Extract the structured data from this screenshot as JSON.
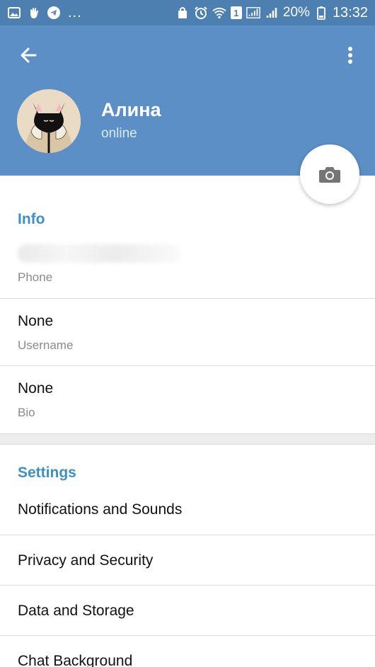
{
  "status_bar": {
    "left_icons": [
      "image-icon",
      "hand-icon",
      "telegram-icon"
    ],
    "more": "...",
    "sim_badge": "1",
    "battery": "20%",
    "time": "13:32"
  },
  "header": {
    "name": "Алина",
    "status": "online"
  },
  "info": {
    "title": "Info",
    "phone_label": "Phone",
    "username_value": "None",
    "username_label": "Username",
    "bio_value": "None",
    "bio_label": "Bio"
  },
  "settings": {
    "title": "Settings",
    "items": [
      {
        "label": "Notifications and Sounds"
      },
      {
        "label": "Privacy and Security"
      },
      {
        "label": "Data and Storage"
      },
      {
        "label": "Chat Background"
      }
    ]
  },
  "colors": {
    "header": "#5b8fc5",
    "status_bar": "#4d7fb0",
    "accent": "#3d8fc4"
  }
}
